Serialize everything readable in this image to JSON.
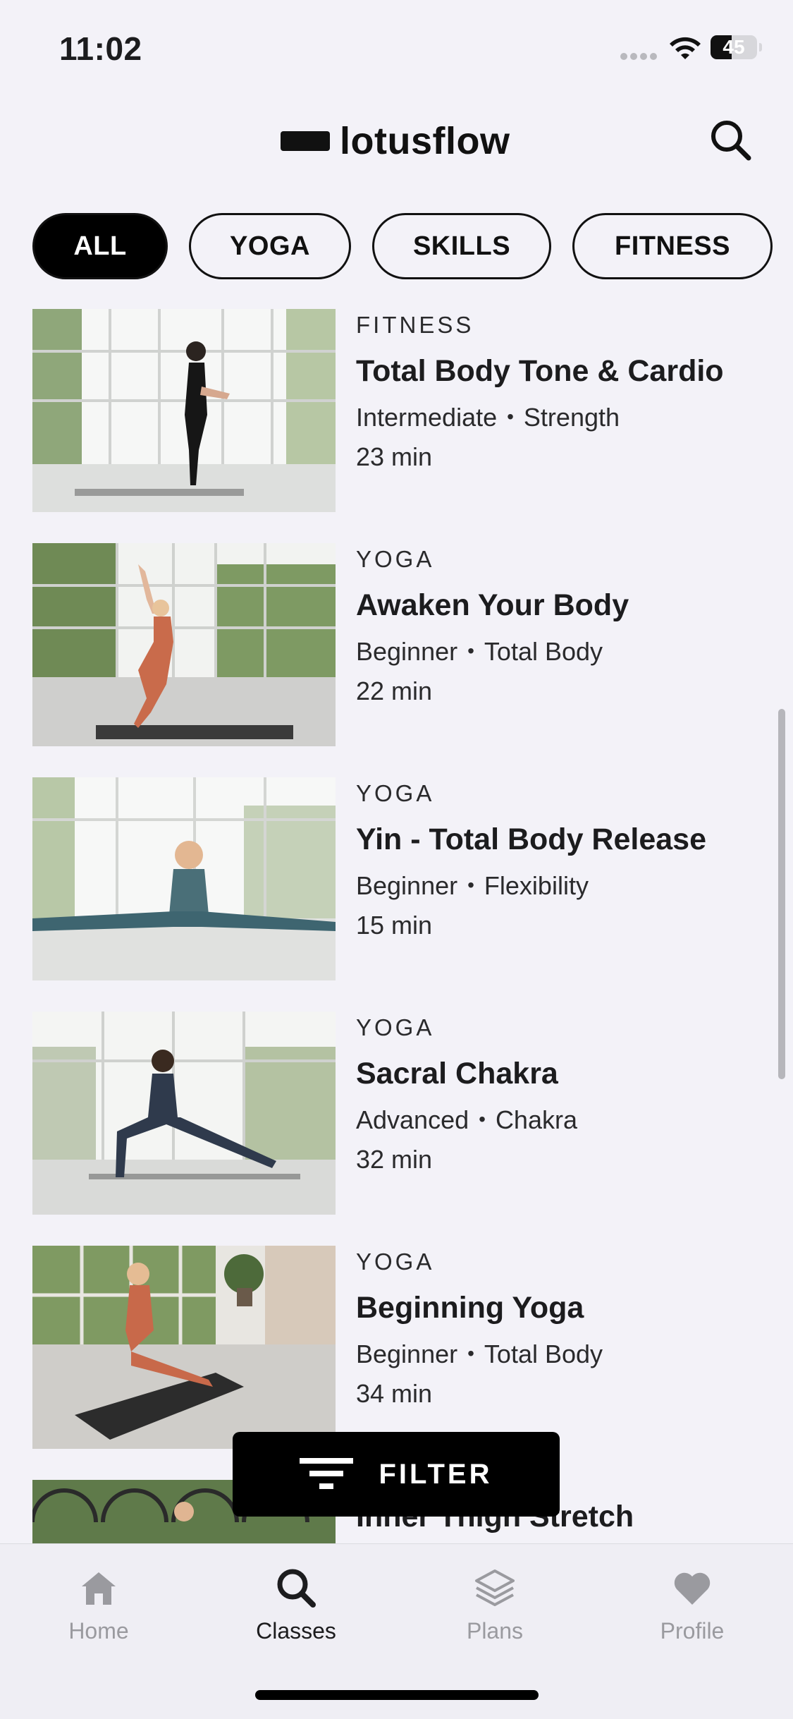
{
  "status_bar": {
    "time": "11:02",
    "battery": "45",
    "battery_level": 0.45
  },
  "header": {
    "brand": "lotusflow"
  },
  "chips": [
    {
      "label": "ALL",
      "active": true
    },
    {
      "label": "YOGA",
      "active": false
    },
    {
      "label": "SKILLS",
      "active": false
    },
    {
      "label": "FITNESS",
      "active": false
    }
  ],
  "classes": [
    {
      "category": "FITNESS",
      "title": "Total Body Tone & Cardio",
      "level": "Intermediate",
      "focus": "Strength",
      "duration": "23 min"
    },
    {
      "category": "YOGA",
      "title": "Awaken Your Body",
      "level": "Beginner",
      "focus": "Total Body",
      "duration": "22 min"
    },
    {
      "category": "YOGA",
      "title": "Yin - Total Body Release",
      "level": "Beginner",
      "focus": "Flexibility",
      "duration": "15 min"
    },
    {
      "category": "YOGA",
      "title": "Sacral Chakra",
      "level": "Advanced",
      "focus": "Chakra",
      "duration": "32 min"
    },
    {
      "category": "YOGA",
      "title": "Beginning Yoga",
      "level": "Beginner",
      "focus": "Total Body",
      "duration": "34 min"
    },
    {
      "category": "",
      "title": "Inner Thigh Stretch",
      "level": "",
      "focus": "",
      "duration": ""
    }
  ],
  "meta_separator": "•",
  "filter_button": {
    "label": "FILTER"
  },
  "tab_bar": [
    {
      "label": "Home",
      "icon": "house-icon",
      "active": false
    },
    {
      "label": "Classes",
      "icon": "search-icon",
      "active": true
    },
    {
      "label": "Plans",
      "icon": "layers-icon",
      "active": false
    },
    {
      "label": "Profile",
      "icon": "heart-icon",
      "active": false
    }
  ],
  "colors": {
    "background": "#f3f2f8",
    "accent": "#000000",
    "inactive_tab": "#9a9a9f"
  }
}
